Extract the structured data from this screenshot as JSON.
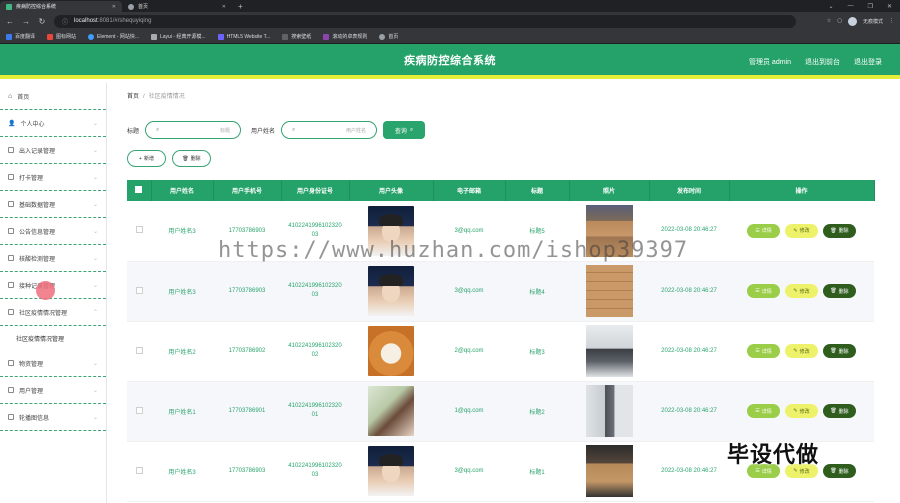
{
  "browser": {
    "tabs": [
      {
        "title": "疾病防控综合系统",
        "active": true
      },
      {
        "title": "首页",
        "active": false
      }
    ],
    "url_host": "localhost",
    "url_path": ":8081/#/shequyiqing",
    "profile_label": "无痕模式",
    "bookmarks": [
      "百度翻译",
      "图标网站",
      "Element - 网站快...",
      "Layui - 经典开源模...",
      "HTML5 Website T...",
      "搜索壁纸",
      "滚动的卓表规则",
      "首页"
    ]
  },
  "header": {
    "title": "疾病防控综合系统",
    "links": [
      "管理员 admin",
      "退出到前台",
      "退出登录"
    ]
  },
  "sidebar": {
    "items": [
      {
        "label": "首页",
        "icon": "home-icon"
      },
      {
        "label": "个人中心",
        "icon": "user-icon"
      },
      {
        "label": "出入记录管理",
        "icon": "log-icon"
      },
      {
        "label": "打卡管理",
        "icon": "checkin-icon"
      },
      {
        "label": "基础数据管理",
        "icon": "database-icon"
      },
      {
        "label": "公告信息管理",
        "icon": "notice-icon"
      },
      {
        "label": "核酸检测管理",
        "icon": "test-icon"
      },
      {
        "label": "接种记录管理",
        "icon": "vaccine-icon"
      },
      {
        "label": "社区疫情情况管理",
        "icon": "community-icon"
      }
    ],
    "sub_item": "社区疫情情况管理",
    "items_after": [
      {
        "label": "物资管理",
        "icon": "supplies-icon"
      },
      {
        "label": "用户管理",
        "icon": "users-icon"
      },
      {
        "label": "轮播图信息",
        "icon": "carousel-icon"
      }
    ]
  },
  "breadcrumb": {
    "home": "首页",
    "current": "社区疫情情况"
  },
  "search": {
    "label1": "标题",
    "placeholder1": "标题",
    "label2": "用户姓名",
    "placeholder2": "用户姓名",
    "query_label": "查询"
  },
  "actions": {
    "add_label": "新增",
    "delete_label": "删除"
  },
  "table": {
    "headers": [
      "用户姓名",
      "用户手机号",
      "用户身份证号",
      "用户头像",
      "电子邮箱",
      "标题",
      "照片",
      "发布时间",
      "操作"
    ],
    "op_labels": {
      "detail": "详情",
      "edit": "修改",
      "delete": "删除"
    },
    "rows": [
      {
        "name": "用户姓名3",
        "phone": "17703786903",
        "idcard": "410224199610232003",
        "avatar": "boy",
        "email": "3@qq.com",
        "title": "标题5",
        "photo": "boxes",
        "time": "2022-03-08 20:46:27"
      },
      {
        "name": "用户姓名3",
        "phone": "17703786903",
        "idcard": "410224199610232003",
        "avatar": "boy",
        "email": "3@qq.com",
        "title": "标题4",
        "photo": "boxes2",
        "time": "2022-03-08 20:46:27"
      },
      {
        "name": "用户姓名2",
        "phone": "17703786902",
        "idcard": "410224199610232002",
        "avatar": "dog",
        "email": "2@qq.com",
        "title": "标题3",
        "photo": "store",
        "time": "2022-03-08 20:46:27"
      },
      {
        "name": "用户姓名1",
        "phone": "17703786901",
        "idcard": "410224199610232001",
        "avatar": "girl",
        "email": "1@qq.com",
        "title": "标题2",
        "photo": "store2",
        "time": "2022-03-08 20:46:27"
      },
      {
        "name": "用户姓名3",
        "phone": "17703786903",
        "idcard": "410224199610232003",
        "avatar": "boy",
        "email": "3@qq.com",
        "title": "标题1",
        "photo": "dark",
        "time": "2022-03-08 20:46:27"
      }
    ]
  },
  "watermark": {
    "url": "https://www.huzhan.com/ishop39397",
    "cn": "毕设代做"
  }
}
